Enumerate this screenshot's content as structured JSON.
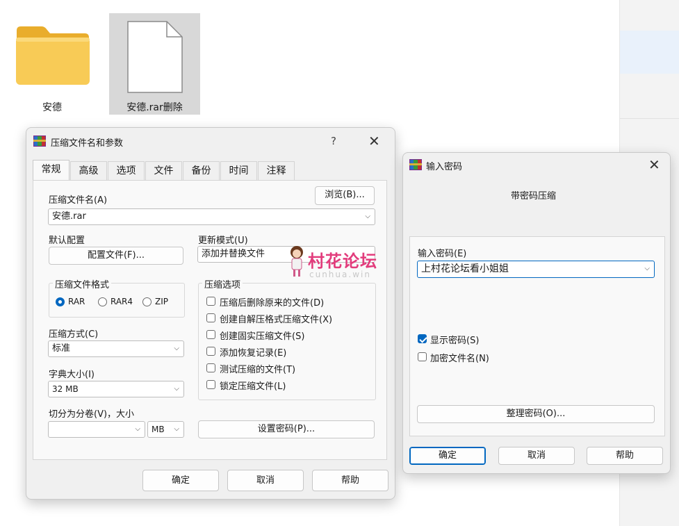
{
  "desktop": {
    "folder_label": "安德",
    "file_label": "安德.rar删除"
  },
  "dialog1": {
    "title": "压缩文件名和参数",
    "help_glyph": "?",
    "tabs": [
      "常规",
      "高级",
      "选项",
      "文件",
      "备份",
      "时间",
      "注释"
    ],
    "archive_name_label": "压缩文件名(A)",
    "browse_button": "浏览(B)...",
    "archive_name_value": "安德.rar",
    "default_profile_label": "默认配置",
    "profiles_button": "配置文件(F)...",
    "update_mode_label": "更新模式(U)",
    "update_mode_value": "添加并替换文件",
    "format_group_title": "压缩文件格式",
    "format_options": [
      "RAR",
      "RAR4",
      "ZIP"
    ],
    "format_selected": "RAR",
    "compression_method_label": "压缩方式(C)",
    "compression_method_value": "标准",
    "dictionary_label": "字典大小(I)",
    "dictionary_value": "32 MB",
    "split_label": "切分为分卷(V)，大小",
    "split_value": "",
    "split_unit": "MB",
    "options_group_title": "压缩选项",
    "options": [
      {
        "label": "压缩后删除原来的文件(D)",
        "checked": false
      },
      {
        "label": "创建自解压格式压缩文件(X)",
        "checked": false
      },
      {
        "label": "创建固实压缩文件(S)",
        "checked": false
      },
      {
        "label": "添加恢复记录(E)",
        "checked": false
      },
      {
        "label": "测试压缩的文件(T)",
        "checked": false
      },
      {
        "label": "锁定压缩文件(L)",
        "checked": false
      }
    ],
    "set_password_button": "设置密码(P)...",
    "ok_button": "确定",
    "cancel_button": "取消",
    "help_button": "帮助"
  },
  "watermark": {
    "text": "村花论坛",
    "subtext": "cunhua.win",
    "color": "#e23c7c"
  },
  "dialog2": {
    "title": "输入密码",
    "heading": "带密码压缩",
    "password_label": "输入密码(E)",
    "password_value": "上村花论坛看小姐姐",
    "show_password_label": "显示密码(S)",
    "show_password_checked": true,
    "encrypt_names_label": "加密文件名(N)",
    "encrypt_names_checked": false,
    "organize_button": "整理密码(O)...",
    "ok_button": "确定",
    "cancel_button": "取消",
    "help_button": "帮助"
  },
  "colors": {
    "accent": "#0067c0",
    "dialog_bg": "#f0f0f0",
    "folder_yellow": "#f7c84a"
  }
}
